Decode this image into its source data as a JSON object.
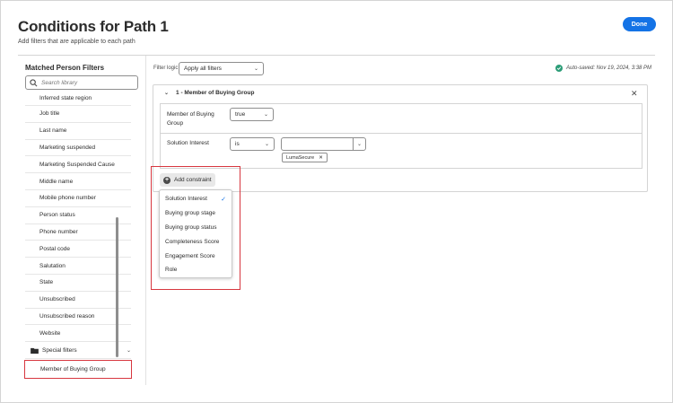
{
  "header": {
    "title": "Conditions for Path 1",
    "subtitle": "Add filters that are applicable to each path",
    "done_label": "Done"
  },
  "sidebar": {
    "title": "Matched Person Filters",
    "search_placeholder": "Search library",
    "items": [
      "Inferred state region",
      "Job title",
      "Last name",
      "Marketing suspended",
      "Marketing Suspended Cause",
      "Middle name",
      "Mobile phone number",
      "Person status",
      "Phone number",
      "Postal code",
      "Salutation",
      "State",
      "Unsubscribed",
      "Unsubscribed reason",
      "Website"
    ],
    "folder_label": "Special filters",
    "highlighted_item": "Member of Buying Group"
  },
  "toolbar": {
    "filter_logic_label": "Filter logic",
    "filter_logic_value": "Apply all filters",
    "autosave_text": "Auto-saved: Nov 19, 2024, 3:38 PM"
  },
  "group": {
    "header": "1 - Member of Buying Group",
    "row1": {
      "label": "Member of Buying Group",
      "value": "true"
    },
    "row2": {
      "label": "Solution Interest",
      "operator": "is",
      "tag": "LumaSecure"
    },
    "add_constraint_label": "Add constraint"
  },
  "dropdown": {
    "items": [
      {
        "label": "Solution Interest",
        "selected": true
      },
      {
        "label": "Buying group stage",
        "selected": false
      },
      {
        "label": "Buying group status",
        "selected": false
      },
      {
        "label": "Completeness Score",
        "selected": false
      },
      {
        "label": "Engagement Score",
        "selected": false
      },
      {
        "label": "Role",
        "selected": false
      }
    ]
  },
  "colors": {
    "accent": "#1473e6",
    "highlight": "#d7373f",
    "success": "#2d9d78"
  }
}
